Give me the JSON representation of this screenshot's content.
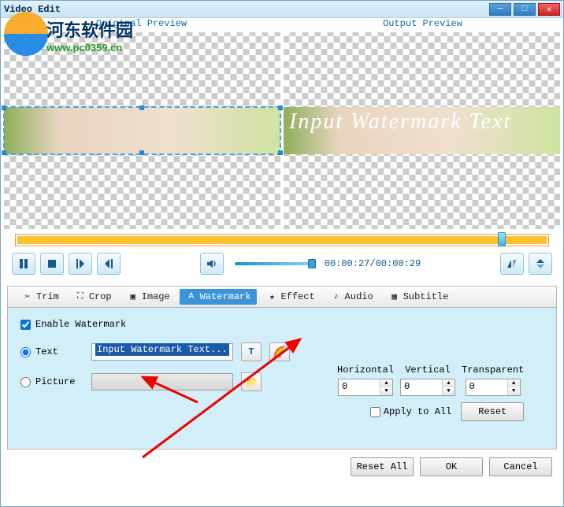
{
  "window": {
    "title": "Video Edit"
  },
  "logo": {
    "cn": "河东软件园",
    "url": "www.pc0359.cn"
  },
  "preview": {
    "original_label": "Original Preview",
    "output_label": "Output Preview",
    "watermark_sample": "Input Watermark Text"
  },
  "playback": {
    "time": "00:00:27/00:00:29"
  },
  "tabs": {
    "trim": "Trim",
    "crop": "Crop",
    "image": "Image",
    "watermark": "Watermark",
    "effect": "Effect",
    "audio": "Audio",
    "subtitle": "Subtitle"
  },
  "watermark": {
    "enable_label": "Enable Watermark",
    "text_radio": "Text",
    "text_value": "Input Watermark Text...",
    "picture_radio": "Picture",
    "sliders": {
      "h_label": "Horizontal",
      "h_value": "0",
      "v_label": "Vertical",
      "v_value": "0",
      "t_label": "Transparent",
      "t_value": "0"
    },
    "apply_all": "Apply to All",
    "reset": "Reset"
  },
  "buttons": {
    "reset_all": "Reset All",
    "ok": "OK",
    "cancel": "Cancel"
  }
}
